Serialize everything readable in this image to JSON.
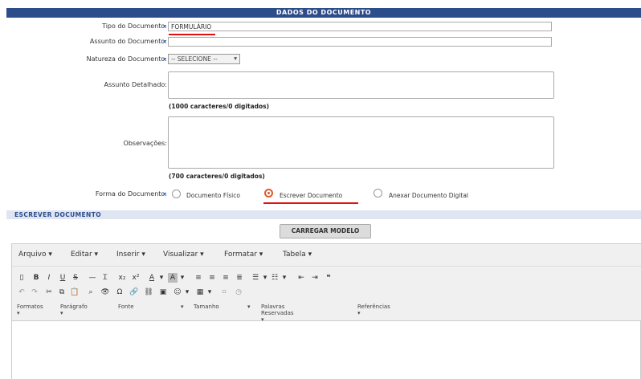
{
  "header": {
    "title": "Dados do Documento"
  },
  "fields": {
    "tipo": {
      "label": "Tipo do Documento:",
      "value": "FORMULÁRIO"
    },
    "assunto": {
      "label": "Assunto do Documento:",
      "value": ""
    },
    "natureza": {
      "label": "Natureza do Documento:",
      "value": "-- SELECIONE --"
    },
    "assunto_detalhado": {
      "label": "Assunto Detalhado:",
      "counter": "(1000 caracteres/0 digitados)"
    },
    "observacoes": {
      "label": "Observações:",
      "counter": "(700 caracteres/0 digitados)"
    },
    "forma": {
      "label": "Forma do Documento:",
      "options": [
        "Documento Físico",
        "Escrever Documento",
        "Anexar Documento Digital"
      ],
      "selected": "Escrever Documento"
    }
  },
  "section2": {
    "title": "Escrever Documento"
  },
  "buttons": {
    "carregar": "CARREGAR MODELO"
  },
  "editor": {
    "menu": [
      "Arquivo",
      "Editar",
      "Inserir",
      "Visualizar",
      "Formatar",
      "Tabela"
    ],
    "format_bar": [
      "Formatos",
      "Parágrafo",
      "Fonte",
      "Tamanho",
      "Palavras Reservadas",
      "Referências"
    ]
  },
  "colors": {
    "header_bg": "#2d4c8a",
    "accent": "#e05a2a",
    "underline": "#e01010"
  }
}
